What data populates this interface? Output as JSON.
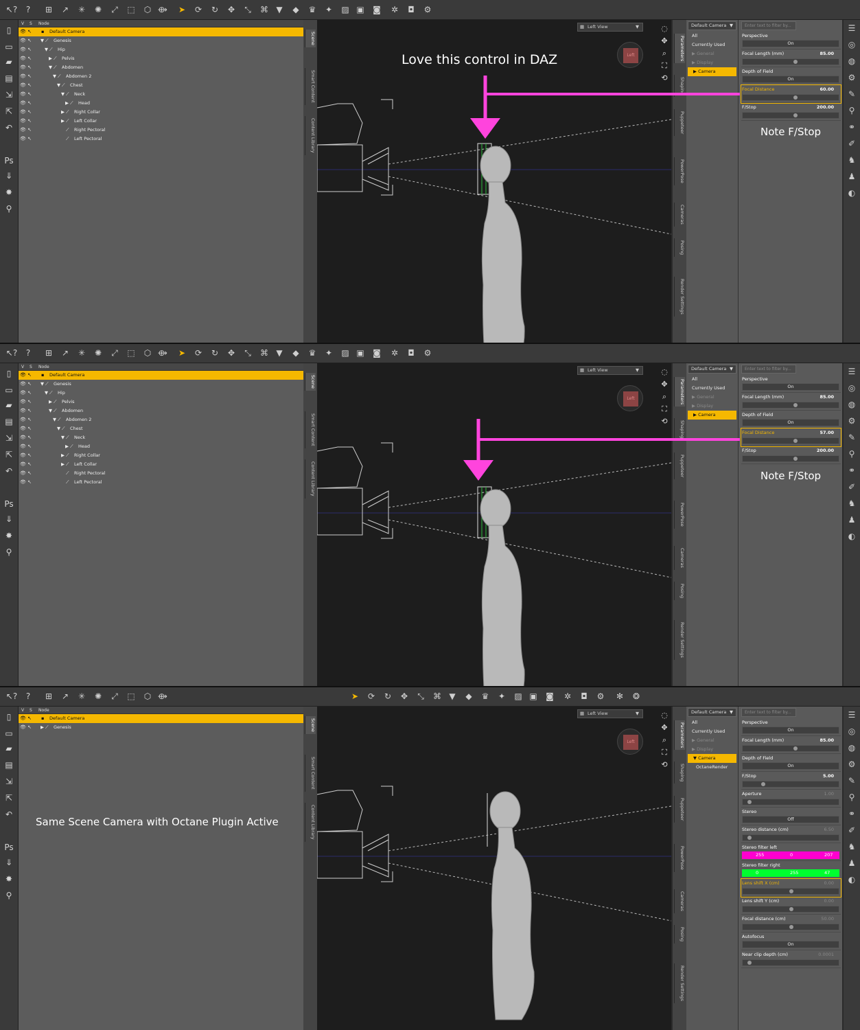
{
  "annotations": {
    "love_control": "Love this control in DAZ",
    "note_fstop": "Note F/Stop",
    "octane_caption": "Same Scene Camera with Octane Plugin Active"
  },
  "viewport": {
    "view_label": "Left View",
    "cube_label": "Left"
  },
  "scene": {
    "header_v": "V",
    "header_s": "S",
    "header_node": "Node"
  },
  "tree_full": [
    {
      "label": "Default Camera",
      "indent": 0,
      "arrow": ""
    },
    {
      "label": "Genesis",
      "indent": 1,
      "arrow": "▼"
    },
    {
      "label": "Hip",
      "indent": 2,
      "arrow": "▼"
    },
    {
      "label": "Pelvis",
      "indent": 3,
      "arrow": "▶"
    },
    {
      "label": "Abdomen",
      "indent": 3,
      "arrow": "▼"
    },
    {
      "label": "Abdomen 2",
      "indent": 4,
      "arrow": "▼"
    },
    {
      "label": "Chest",
      "indent": 5,
      "arrow": "▼"
    },
    {
      "label": "Neck",
      "indent": 6,
      "arrow": "▼"
    },
    {
      "label": "Head",
      "indent": 7,
      "arrow": "▶"
    },
    {
      "label": "Right Collar",
      "indent": 6,
      "arrow": "▶"
    },
    {
      "label": "Left Collar",
      "indent": 6,
      "arrow": "▶"
    },
    {
      "label": "Right Pectoral",
      "indent": 6,
      "arrow": ""
    },
    {
      "label": "Left Pectoral",
      "indent": 6,
      "arrow": ""
    }
  ],
  "tree_short": [
    {
      "label": "Default Camera",
      "indent": 0,
      "arrow": ""
    },
    {
      "label": "Genesis",
      "indent": 1,
      "arrow": "▶"
    }
  ],
  "side_tabs": [
    "Scene",
    "Smart Content",
    "Content Library"
  ],
  "param_tabs": [
    "Parameters",
    "Shaping",
    "Puppeteer",
    "PowerPose",
    "Cameras",
    "Posing",
    "Render Settings"
  ],
  "params_left": {
    "dropdown": "Default Camera",
    "items": [
      "All",
      "Currently Used",
      "General",
      "Display",
      "Camera"
    ],
    "octane_item": "OctaneRender"
  },
  "filter_placeholder": "Enter text to filter by...",
  "panel1_props": [
    {
      "label": "Perspective",
      "type": "toggle",
      "value": "On"
    },
    {
      "label": "Focal Length (mm)",
      "type": "slider",
      "value": "85.00",
      "pos": 0.55
    },
    {
      "label": "Depth of Field",
      "type": "toggle",
      "value": "On"
    },
    {
      "label": "Focal Distance",
      "type": "slider",
      "value": "60.00",
      "pos": 0.55,
      "hi": true
    },
    {
      "label": "F/Stop",
      "type": "slider",
      "value": "200.00",
      "pos": 0.55
    }
  ],
  "panel2_props": [
    {
      "label": "Perspective",
      "type": "toggle",
      "value": "On"
    },
    {
      "label": "Focal Length (mm)",
      "type": "slider",
      "value": "85.00",
      "pos": 0.55
    },
    {
      "label": "Depth of Field",
      "type": "toggle",
      "value": "On"
    },
    {
      "label": "Focal Distance",
      "type": "slider",
      "value": "57.00",
      "pos": 0.55,
      "hi": true
    },
    {
      "label": "F/Stop",
      "type": "slider",
      "value": "200.00",
      "pos": 0.55
    }
  ],
  "panel3_props": [
    {
      "label": "Perspective",
      "type": "toggle",
      "value": "On"
    },
    {
      "label": "Focal Length (mm)",
      "type": "slider",
      "value": "85.00",
      "pos": 0.55
    },
    {
      "label": "Depth of Field",
      "type": "toggle",
      "value": "On"
    },
    {
      "label": "F/Stop",
      "type": "slider",
      "value": "5.00",
      "pos": 0.2
    },
    {
      "label": "Aperture",
      "type": "slider",
      "value": "1.00",
      "pos": 0.05,
      "dim": true
    },
    {
      "label": "Stereo",
      "type": "toggle",
      "value": "Off"
    },
    {
      "label": "Stereo distance (cm)",
      "type": "slider",
      "value": "6.50",
      "pos": 0.05,
      "dim": true
    },
    {
      "label": "Stereo filter left",
      "type": "rgb",
      "rgb": [
        "255",
        "0",
        "207"
      ],
      "color": "#ff00cf"
    },
    {
      "label": "Stereo filter right",
      "type": "rgb",
      "rgb": [
        "0",
        "255",
        "47"
      ],
      "color": "#00ff2f"
    },
    {
      "label": "Lens shift X (cm)",
      "type": "slider",
      "value": "0.00",
      "pos": 0.5,
      "dim": true,
      "hi": true
    },
    {
      "label": "Lens shift Y (cm)",
      "type": "slider",
      "value": "0.00",
      "pos": 0.5,
      "dim": true
    },
    {
      "label": "Focal distance (cm)",
      "type": "slider",
      "value": "50.00",
      "pos": 0.5,
      "dim": true
    },
    {
      "label": "Autofocus",
      "type": "toggle",
      "value": "On"
    },
    {
      "label": "Near clip depth (cm)",
      "type": "slider",
      "value": "0.0001",
      "pos": 0.05,
      "dim": true
    }
  ],
  "colors": {
    "accent": "#f5b800",
    "annotation": "#ff44dd",
    "panel_bg": "#5c5c5c",
    "viewport_bg": "#1d1d1d"
  },
  "toolbar_icons": [
    "whats-this",
    "help",
    "node-tool",
    "joint-tool",
    "universal",
    "region",
    "rotate",
    "translate",
    "scale",
    "camera",
    "render",
    "settings"
  ]
}
